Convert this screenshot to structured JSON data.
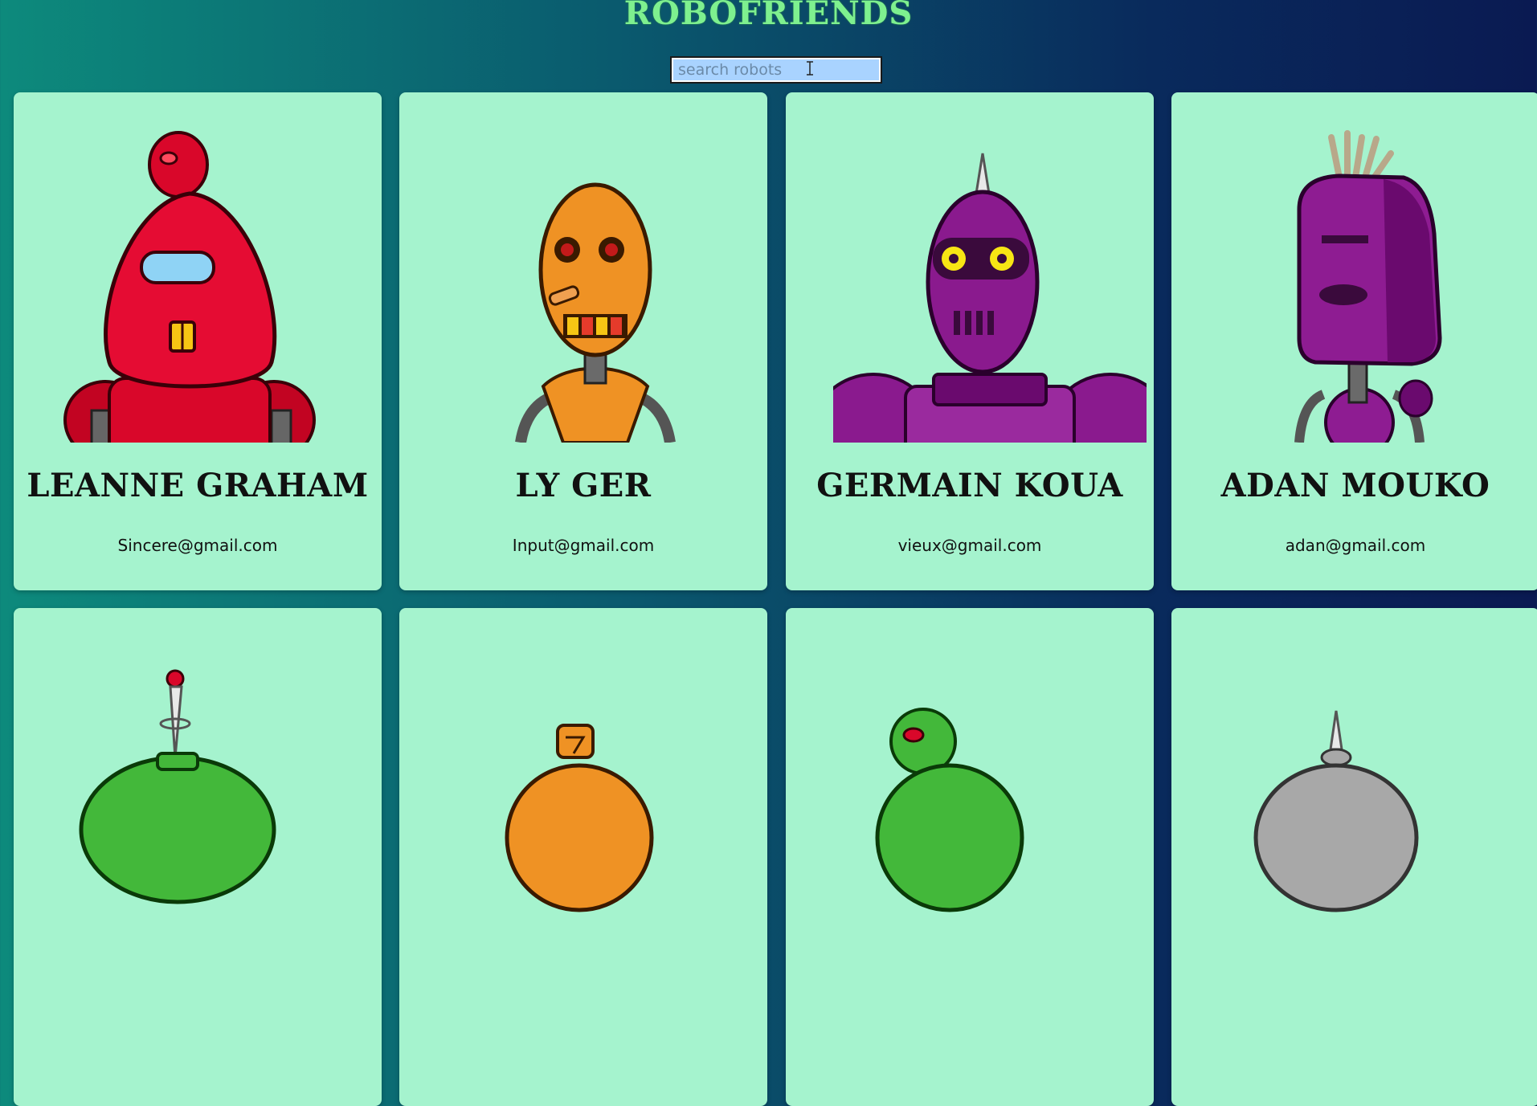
{
  "header": {
    "title": "ROBOFRIENDS"
  },
  "search": {
    "placeholder": "search robots",
    "value": ""
  },
  "robots": [
    {
      "name": "LEANNE GRAHAM",
      "email": "Sincere@gmail.com",
      "color": "#d9072a"
    },
    {
      "name": "LY GER",
      "email": "Input@gmail.com",
      "color": "#ef9224"
    },
    {
      "name": "GERMAIN KOUA",
      "email": "vieux@gmail.com",
      "color": "#8a1a8e"
    },
    {
      "name": "ADAN MOUKO",
      "email": "adan@gmail.com",
      "color": "#8e1c92"
    },
    {
      "name": "",
      "email": "",
      "color": "#43b83a"
    },
    {
      "name": "",
      "email": "",
      "color": "#ef9224"
    },
    {
      "name": "",
      "email": "",
      "color": "#43b83a"
    },
    {
      "name": "",
      "email": "",
      "color": "#a8a8a8"
    }
  ],
  "colors": {
    "card_bg": "#a5f3ce",
    "title": "#7ef08f",
    "search_bg": "#a9d3ff"
  }
}
